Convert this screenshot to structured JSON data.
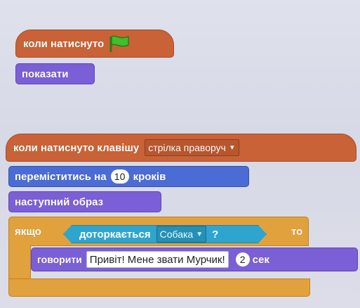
{
  "script1": {
    "hat_label": "коли натиснуто",
    "flag_icon": "green-flag-icon",
    "show_label": "показати"
  },
  "script2": {
    "hat_label": "коли натиснуто клавішу",
    "key_option": "стрілка праворуч",
    "move_label": "переміститись на",
    "move_steps": "10",
    "move_unit": "кроків",
    "next_costume_label": "наступний образ",
    "if_label": "якщо",
    "touching_label": "доторкається",
    "touching_option": "Собака",
    "touching_q": "?",
    "then_label": "то",
    "say_label": "говорити",
    "say_text": "Привіт! Мене звати Мурчик!",
    "say_secs": "2",
    "secs_label": "сек"
  },
  "colors": {
    "events": "#c96236",
    "looks": "#7b5fd6",
    "motion": "#4a6cd4",
    "control": "#e1a13c",
    "sensing": "#2ea5cf"
  }
}
